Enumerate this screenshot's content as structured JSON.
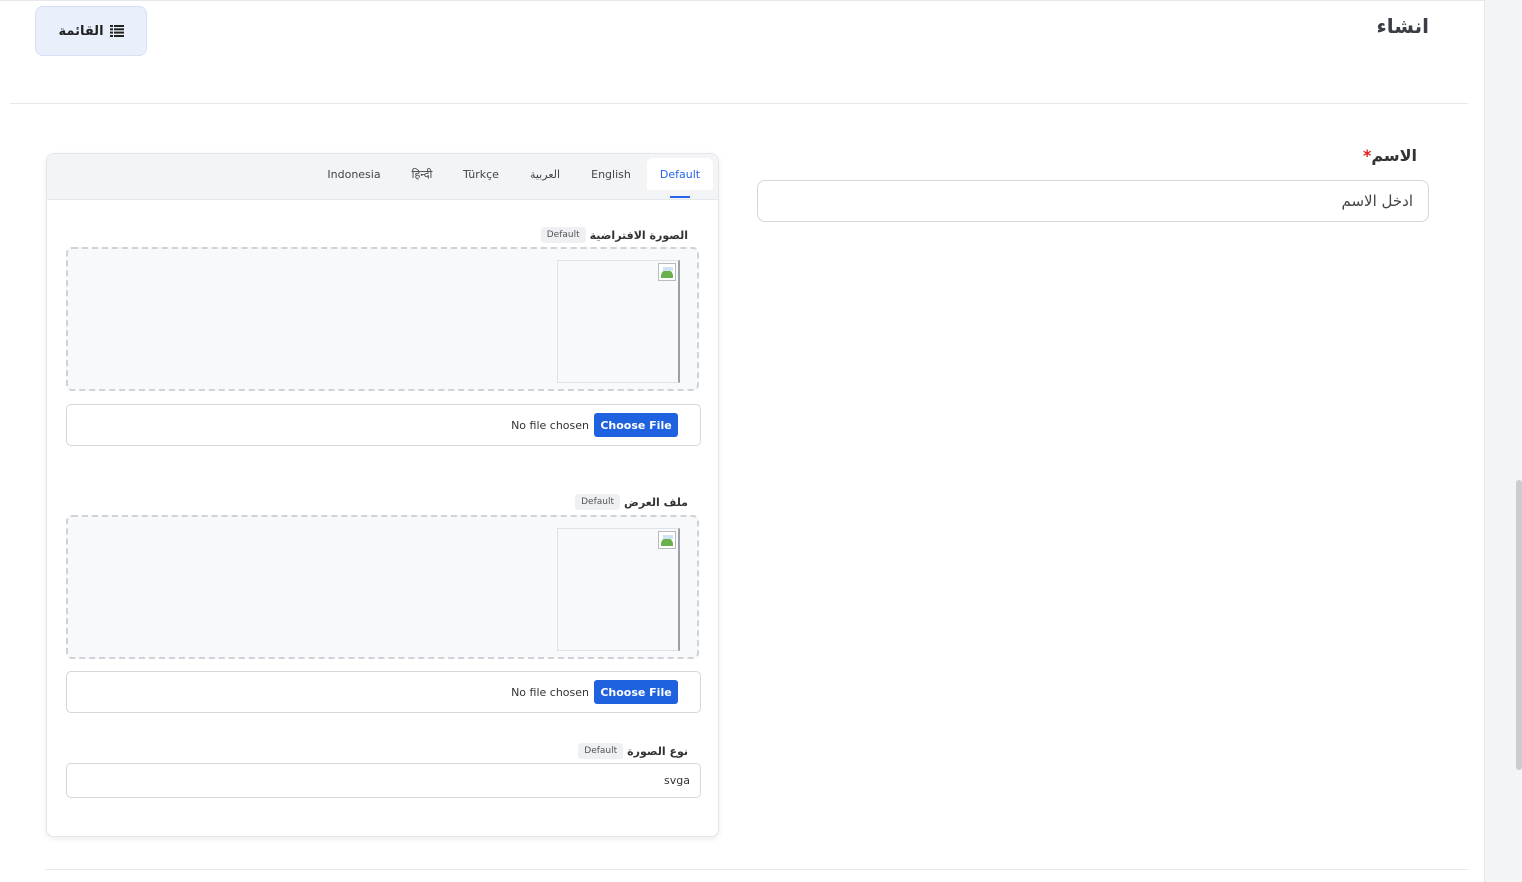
{
  "header": {
    "title": "انشاء",
    "list_button_label": "القائمة",
    "list_icon": "list-icon"
  },
  "name_field": {
    "label": "الاسم",
    "required_mark": "*",
    "placeholder": "ادخل الاسم"
  },
  "language_tabs": [
    {
      "label": "Default",
      "active": true
    },
    {
      "label": "English",
      "active": false
    },
    {
      "label": "العربية",
      "active": false
    },
    {
      "label": "Türkçe",
      "active": false
    },
    {
      "label": "हिन्दी",
      "active": false
    },
    {
      "label": "Indonesia",
      "active": false
    }
  ],
  "default_image": {
    "label": "الصورة الافتراضية",
    "badge": "Default",
    "file_button": "Choose File",
    "file_status": "No file chosen"
  },
  "display_file": {
    "label": "ملف العرض",
    "badge": "Default",
    "file_button": "Choose File",
    "file_status": "No file chosen"
  },
  "image_type": {
    "label": "نوع الصورة",
    "badge": "Default",
    "value": "svga"
  },
  "colors": {
    "accent": "#2563eb",
    "required": "#e11d1d",
    "button_bg": "#eaf0fb"
  }
}
